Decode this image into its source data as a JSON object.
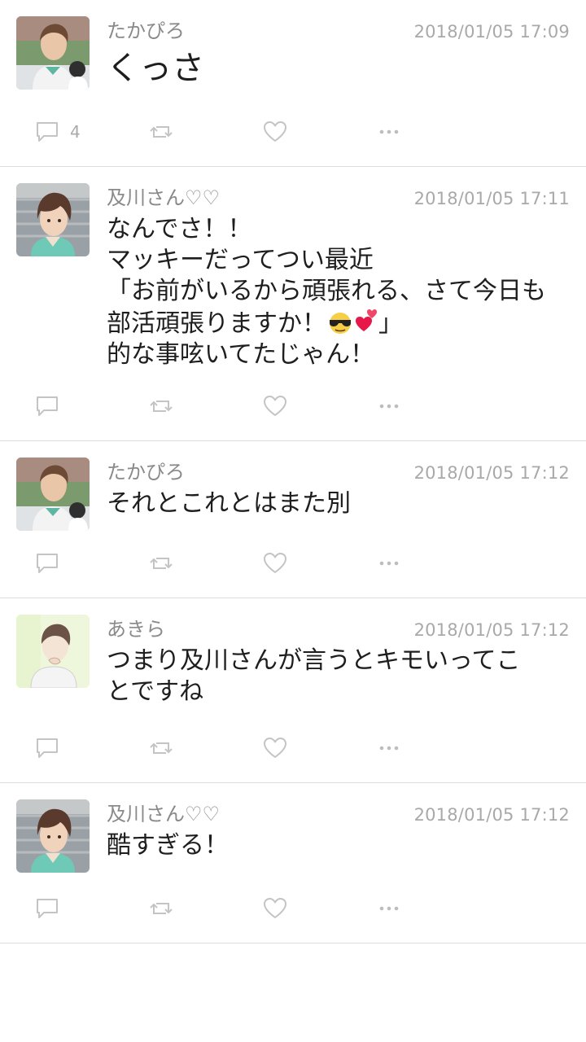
{
  "posts": [
    {
      "user": "たかぴろ",
      "time": "2018/01/05 17:09",
      "text": "くっさ",
      "comment_count": "4",
      "avatar": "brown-hair-avatar"
    },
    {
      "user": "及川さん♡♡",
      "time": "2018/01/05 17:11",
      "lines": [
        "なんでさ！！",
        "マッキーだってつい最近",
        "「お前がいるから頑張れる、さて今日も",
        "部活頑張りますか！",
        "」",
        "的な事呟いてたじゃん！"
      ],
      "emojis": [
        "sunglasses-emoji",
        "hearts-emoji"
      ],
      "avatar": "dark-hair-avatar"
    },
    {
      "user": "たかぴろ",
      "time": "2018/01/05 17:12",
      "text": "それとこれとはまた別",
      "avatar": "brown-hair-avatar"
    },
    {
      "user": "あきら",
      "time": "2018/01/05 17:12",
      "lines": [
        "つまり及川さんが言うとキモいってこ",
        "とですね"
      ],
      "avatar": "pale-avatar"
    },
    {
      "user": "及川さん♡♡",
      "time": "2018/01/05 17:12",
      "text": "酷すぎる！",
      "avatar": "dark-hair-avatar"
    }
  ],
  "colors": {
    "icon": "#c4c4c4",
    "username": "#8a8a8a",
    "timestamp": "#a9a9a9",
    "divider": "#dcdcdc"
  },
  "icons": [
    "comment-icon",
    "retweet-icon",
    "like-icon",
    "more-icon"
  ]
}
